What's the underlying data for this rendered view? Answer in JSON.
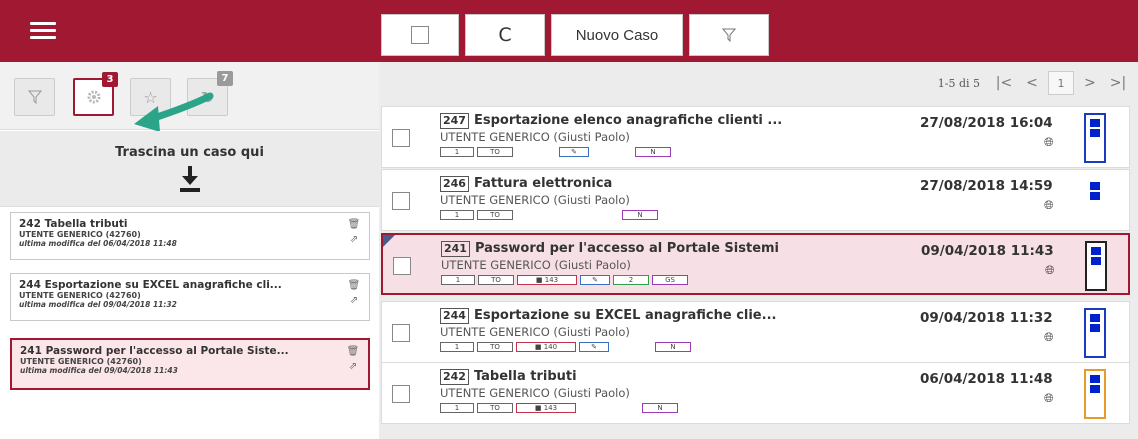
{
  "toolbar": {
    "refresh_label": "C",
    "new_case_label": "Nuovo Caso",
    "filter_icon": "filter-icon"
  },
  "left_tabs": [
    {
      "icon": "filter-icon",
      "badge": ""
    },
    {
      "icon": "gear-icon",
      "badge": "3"
    },
    {
      "icon": "star-icon",
      "badge": ""
    },
    {
      "icon": "history-icon",
      "badge": "7"
    }
  ],
  "dropzone": {
    "text": "Trascina un caso qui"
  },
  "queue": [
    {
      "title": "242 Tabella tributi",
      "user": "UTENTE GENERICO (42760)",
      "modified": "ultima modifica del 06/04/2018 11:48"
    },
    {
      "title": "244 Esportazione su EXCEL anagrafiche cli...",
      "user": "UTENTE GENERICO (42760)",
      "modified": "ultima modifica del 09/04/2018 11:32"
    },
    {
      "title": "241 Password per l'accesso al Portale Siste...",
      "user": "UTENTE GENERICO (42760)",
      "modified": "ultima modifica del 09/04/2018 11:43"
    }
  ],
  "pager": {
    "info": "1-5 di 5",
    "page": "1"
  },
  "cases": [
    {
      "id": "247",
      "title": "Esportazione elenco anagrafiche clienti ...",
      "user": "UTENTE GENERICO (Giusti Paolo)",
      "date": "27/08/2018 16:04",
      "status_color": "#1a3bbf",
      "tags": [
        {
          "t": "1",
          "c": ""
        },
        {
          "t": "TO",
          "c": ""
        },
        {
          "t": "",
          "c": "gap"
        },
        {
          "t": "✎",
          "c": "blue"
        },
        {
          "t": "",
          "c": "gap"
        },
        {
          "t": "N",
          "c": "purple"
        }
      ]
    },
    {
      "id": "246",
      "title": "Fattura elettronica",
      "user": "UTENTE GENERICO (Giusti Paolo)",
      "date": "27/08/2018 14:59",
      "status_color": "",
      "tags": [
        {
          "t": "1",
          "c": ""
        },
        {
          "t": "TO",
          "c": ""
        },
        {
          "t": "",
          "c": "gap"
        },
        {
          "t": "",
          "c": "gap2"
        },
        {
          "t": "N",
          "c": "purple"
        }
      ]
    },
    {
      "id": "241",
      "title": "Password per l'accesso al Portale Sistemi",
      "user": "UTENTE GENERICO (Giusti Paolo)",
      "date": "09/04/2018 11:43",
      "status_color": "#222222",
      "tags": [
        {
          "t": "1",
          "c": ""
        },
        {
          "t": "TO",
          "c": ""
        },
        {
          "t": "■ 143",
          "c": "red"
        },
        {
          "t": "✎",
          "c": "blue"
        },
        {
          "t": "2",
          "c": "green"
        },
        {
          "t": "GS",
          "c": "purple"
        }
      ]
    },
    {
      "id": "244",
      "title": "Esportazione su EXCEL anagrafiche clie...",
      "user": "UTENTE GENERICO (Giusti Paolo)",
      "date": "09/04/2018 11:32",
      "status_color": "#1a3bbf",
      "tags": [
        {
          "t": "1",
          "c": ""
        },
        {
          "t": "TO",
          "c": ""
        },
        {
          "t": "■ 140",
          "c": "red"
        },
        {
          "t": "✎",
          "c": "blue"
        },
        {
          "t": "",
          "c": "gap"
        },
        {
          "t": "N",
          "c": "purple"
        }
      ]
    },
    {
      "id": "242",
      "title": "Tabella tributi",
      "user": "UTENTE GENERICO (Giusti Paolo)",
      "date": "06/04/2018 11:48",
      "status_color": "#e89a2b",
      "tags": [
        {
          "t": "1",
          "c": ""
        },
        {
          "t": "TO",
          "c": ""
        },
        {
          "t": "■ 143",
          "c": "red"
        },
        {
          "t": "",
          "c": "gap2"
        },
        {
          "t": "N",
          "c": "purple"
        }
      ]
    }
  ],
  "colors": {
    "brand": "#a01832",
    "status_blue": "#1a3bbf",
    "status_orange": "#e89a2b"
  }
}
